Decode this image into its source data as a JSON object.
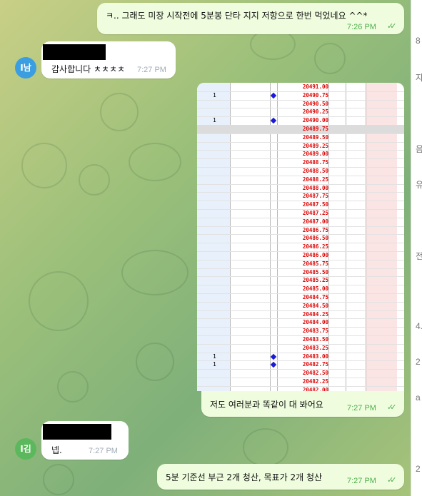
{
  "messages": [
    {
      "id": "m1",
      "text": "ㅋ.. 그래도 미장 시작전에 5분봉 단타 지지 저항으로 한번 먹었네요 ^^*",
      "time": "7:26 PM",
      "outgoing": true
    },
    {
      "id": "m2",
      "text": "감사합니다 ㅊㅊㅊㅊ",
      "time": "7:27 PM",
      "outgoing": false,
      "avatar": "I남",
      "avatar_color": "#3b9ee0"
    },
    {
      "id": "m3",
      "text": "저도 여러분과 똑같이 대 봐어요",
      "time": "7:27 PM",
      "outgoing": true
    },
    {
      "id": "m4",
      "text": "넵.",
      "time": "7:27 PM",
      "outgoing": false,
      "avatar": "I김",
      "avatar_color": "#5cb85c"
    },
    {
      "id": "m5",
      "text": "5분 기준선 부근 2개 청산,  목표가 2개 청산",
      "time": "7:27 PM",
      "outgoing": true
    }
  ],
  "screenshot": {
    "prices": [
      "20491.00",
      "20490.75",
      "20490.50",
      "20490.25",
      "20490.00",
      "20489.75",
      "20489.50",
      "20489.25",
      "20489.00",
      "20488.75",
      "20488.50",
      "20488.25",
      "20488.00",
      "20487.75",
      "20487.50",
      "20487.25",
      "20487.00",
      "20486.75",
      "20486.50",
      "20486.25",
      "20486.00",
      "20485.75",
      "20485.50",
      "20485.25",
      "20485.00",
      "20484.75",
      "20484.50",
      "20484.25",
      "20484.00",
      "20483.75",
      "20483.50",
      "20483.25",
      "20483.00",
      "20482.75",
      "20482.50",
      "20482.25",
      "20482.00"
    ],
    "marked_rows": [
      1,
      4,
      32,
      33
    ],
    "marker_label": "1",
    "selected_row": 5
  },
  "right_panel_chars": [
    "8",
    "자",
    "",
    "음",
    "유",
    "",
    "전",
    "",
    "4.",
    "2",
    "a",
    "",
    "2"
  ]
}
